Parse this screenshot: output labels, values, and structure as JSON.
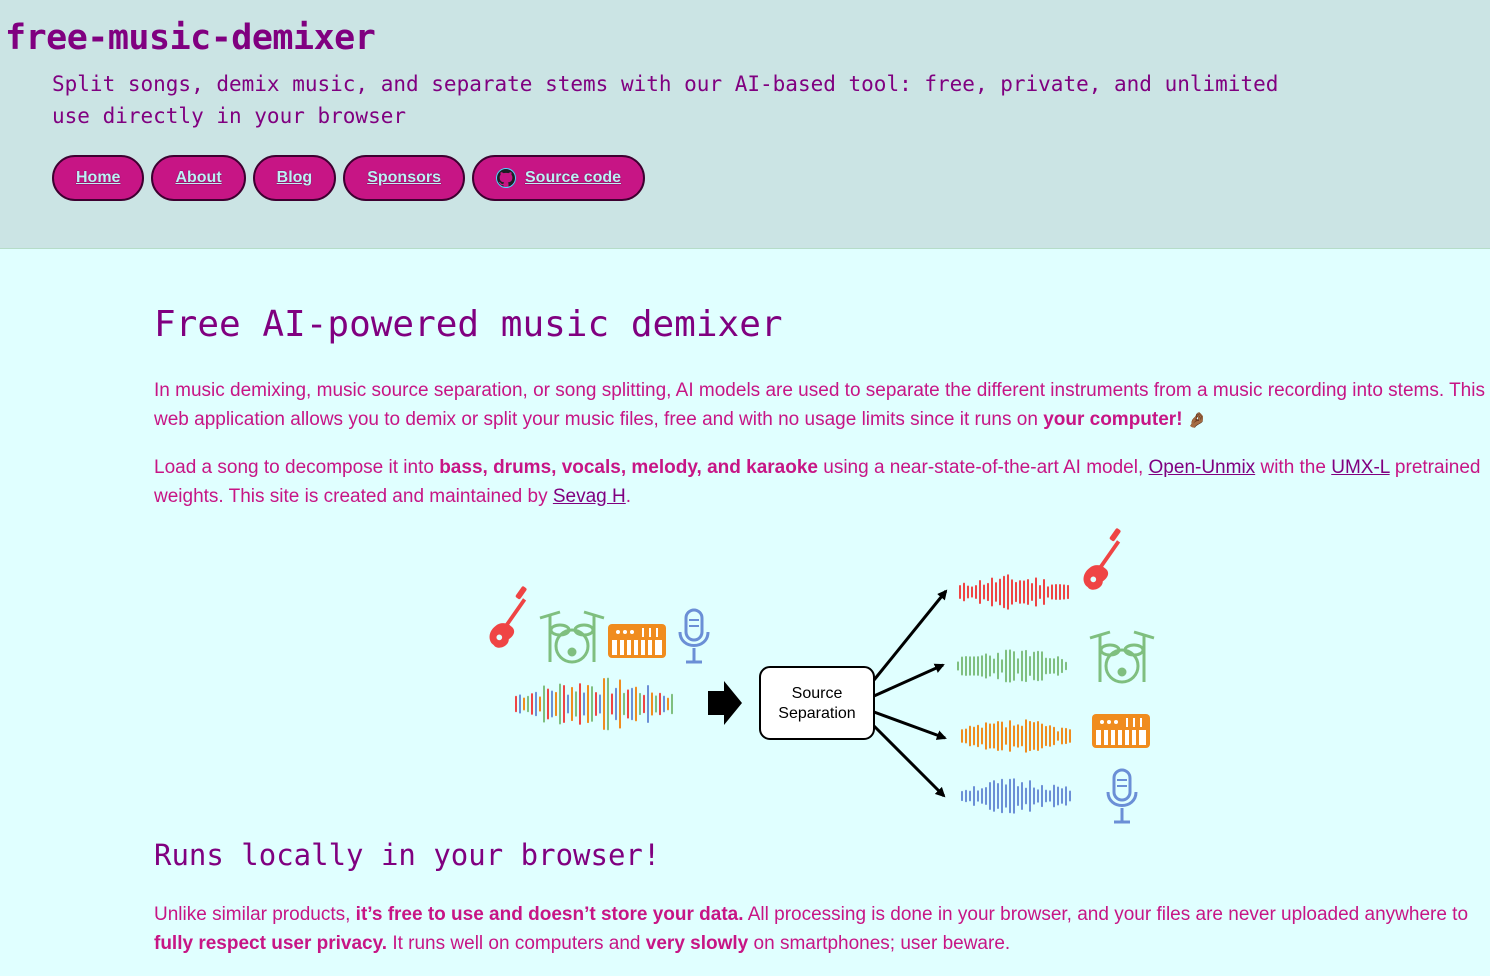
{
  "header": {
    "title": "free-music-demixer",
    "tagline": "Split songs, demix music, and separate stems with our AI-based tool: free, private, and unlimited use directly in your browser"
  },
  "nav": {
    "home": "Home",
    "about": "About",
    "blog": "Blog",
    "sponsors": "Sponsors",
    "source": "Source code"
  },
  "main": {
    "heading": "Free AI-powered music demixer",
    "p1": {
      "text": "In music demixing, music source separation, or song splitting, AI models are used to separate the different instruments from a music recording into stems. This web application allows you to demix or split your music files, free and with no usage limits since it runs on ",
      "bold": "your computer!",
      "emoji": "🤌🏾"
    },
    "p2": {
      "t1": "Load a song to decompose it into ",
      "b1": "bass, drums, vocals, melody, and karaoke",
      "t2": " using a near-state-of-the-art AI model, ",
      "link1": "Open-Unmix",
      "t3": " with the ",
      "link2": "UMX-L",
      "t4": " pretrained weights. This site is created and maintained by ",
      "link3": "Sevag H",
      "t5": "."
    },
    "diagram": {
      "box_line1": "Source",
      "box_line2": "Separation"
    },
    "heading2": "Runs locally in your browser!",
    "p3": {
      "t1": "Unlike similar products, ",
      "b1": "it’s free to use and doesn’t store your data.",
      "t2": " All processing is done in your browser, and your files are never uploaded anywhere to ",
      "b2": "fully respect user privacy.",
      "t3": " It runs well on computers and ",
      "b3": "very slowly",
      "t4": " on smartphones; user beware."
    }
  },
  "colors": {
    "accent": "#c71585",
    "title": "#800080",
    "header_bg": "#cbe4e4",
    "page_bg": "#e0ffff",
    "guitar": "#ef4444",
    "drums": "#7fbf7f",
    "keys": "#f08c1e",
    "vocals": "#6b8fd6"
  }
}
